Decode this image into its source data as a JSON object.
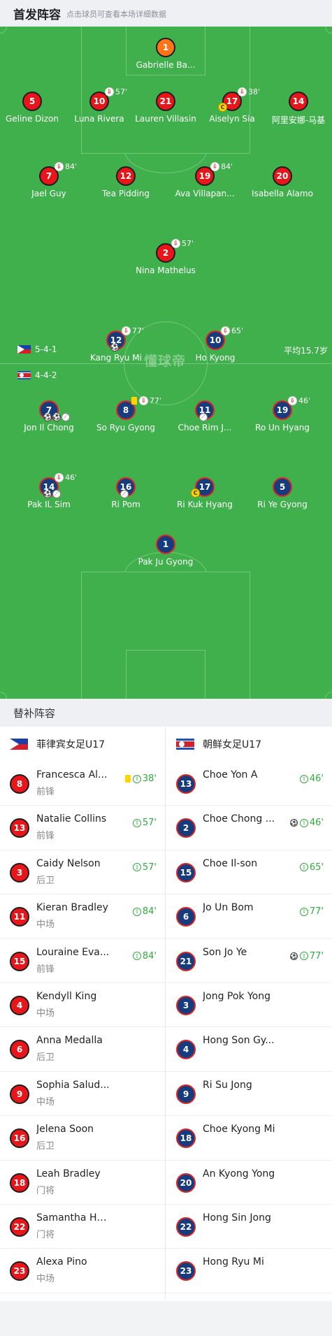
{
  "header": {
    "title": "首发阵容",
    "hint": "点击球员可查看本场详细数据"
  },
  "pitch": {
    "watermark": "懂球帝",
    "home_formation": "5-4-1",
    "away_formation": "4-4-2",
    "avg_age": "平均15.7岁",
    "home_players": [
      {
        "no": "1",
        "name": "Gabrielle Ba...",
        "color": "orange"
      },
      {
        "no": "5",
        "name": "Geline Dizon"
      },
      {
        "no": "10",
        "name": "Luna Rivera",
        "sub": "57'"
      },
      {
        "no": "21",
        "name": "Lauren Villasin"
      },
      {
        "no": "17",
        "name": "Aiselyn Sia",
        "sub": "38'",
        "captain": true
      },
      {
        "no": "14",
        "name": "阿里安娜-马基"
      },
      {
        "no": "7",
        "name": "Jael Guy",
        "sub": "84'"
      },
      {
        "no": "12",
        "name": "Tea Pidding"
      },
      {
        "no": "19",
        "name": "Ava Villapan...",
        "sub": "84'"
      },
      {
        "no": "20",
        "name": "Isabella Alamo"
      },
      {
        "no": "2",
        "name": "Nina Mathelus",
        "sub": "57'"
      }
    ],
    "away_players": [
      {
        "no": "12",
        "name": "Kang Ryu Mi",
        "sub": "77'",
        "goals": 1
      },
      {
        "no": "10",
        "name": "Ho Kyong",
        "sub": "65'"
      },
      {
        "no": "7",
        "name": "Jon Il Chong",
        "goals": 2,
        "assists": 1
      },
      {
        "no": "8",
        "name": "So Ryu Gyong",
        "sub": "77'",
        "yellow": true
      },
      {
        "no": "11",
        "name": "Choe Rim J...",
        "assists": 1
      },
      {
        "no": "19",
        "name": "Ro Un Hyang",
        "sub": "46'"
      },
      {
        "no": "14",
        "name": "Pak IL Sim",
        "sub": "46'",
        "goals": 1,
        "assists": 1
      },
      {
        "no": "16",
        "name": "Ri Pom",
        "assists": 1
      },
      {
        "no": "17",
        "name": "Ri Kuk Hyang",
        "captain": true
      },
      {
        "no": "5",
        "name": "Ri Ye Gyong"
      },
      {
        "no": "1",
        "name": "Pak Ju Gyong"
      }
    ]
  },
  "subs": {
    "title": "替补阵容",
    "home_team": "菲律宾女足U17",
    "away_team": "朝鲜女足U17",
    "home": [
      {
        "no": "8",
        "name": "Francesca Al...",
        "pos": "前锋",
        "min": "38'",
        "yellow": true
      },
      {
        "no": "13",
        "name": "Natalie Collins",
        "pos": "前锋",
        "min": "57'"
      },
      {
        "no": "3",
        "name": "Caidy Nelson",
        "pos": "后卫",
        "min": "57'"
      },
      {
        "no": "11",
        "name": "Kieran Bradley",
        "pos": "中场",
        "min": "84'"
      },
      {
        "no": "15",
        "name": "Louraine Eva...",
        "pos": "前锋",
        "min": "84'"
      },
      {
        "no": "4",
        "name": "Kendyll King",
        "pos": "中场"
      },
      {
        "no": "6",
        "name": "Anna Medalla",
        "pos": "后卫"
      },
      {
        "no": "9",
        "name": "Sophia Salud...",
        "pos": "中场"
      },
      {
        "no": "16",
        "name": "Jelena Soon",
        "pos": "后卫"
      },
      {
        "no": "18",
        "name": "Leah Bradley",
        "pos": "门将"
      },
      {
        "no": "22",
        "name": "Samantha Hu...",
        "pos": "门将"
      },
      {
        "no": "23",
        "name": "Alexa Pino",
        "pos": "中场"
      }
    ],
    "away": [
      {
        "no": "13",
        "name": "Choe Yon A",
        "min": "46'"
      },
      {
        "no": "2",
        "name": "Choe Chong ...",
        "min": "46'",
        "goal": true
      },
      {
        "no": "15",
        "name": "Choe Il-son",
        "min": "65'"
      },
      {
        "no": "6",
        "name": "Jo Un Bom",
        "min": "77'"
      },
      {
        "no": "21",
        "name": "Son Jo Ye",
        "min": "77'",
        "goal": true
      },
      {
        "no": "3",
        "name": "Jong Pok Yong"
      },
      {
        "no": "4",
        "name": "Hong Son Gy..."
      },
      {
        "no": "9",
        "name": "Ri Su Jong"
      },
      {
        "no": "18",
        "name": "Choe Kyong Mi"
      },
      {
        "no": "20",
        "name": "An Kyong Yong"
      },
      {
        "no": "22",
        "name": "Hong Sin Jong"
      },
      {
        "no": "23",
        "name": "Hong Ryu Mi"
      }
    ]
  }
}
